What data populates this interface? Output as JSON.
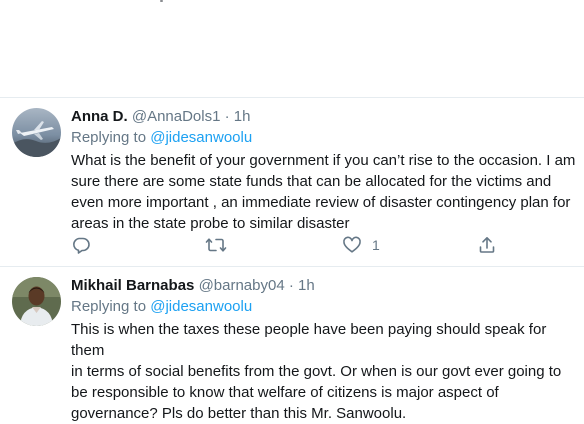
{
  "tweets": [
    {
      "author_name": "Anna D.",
      "handle": "@AnnaDols1",
      "time": "1h",
      "replying_prefix": "Replying to",
      "replying_to": "@jidesanwoolu",
      "body": "What is the benefit of your government if you can’t rise to the occasion. I am\nsure there are some state funds that can be allocated for the victims and\neven more important , an immediate review of disaster contingency plan for\nareas in the state probe to similar disaster",
      "actions": {
        "reply_icon": "reply-icon",
        "retweet_icon": "retweet-icon",
        "like_icon": "heart-icon",
        "like_count": "1",
        "share_icon": "share-icon"
      }
    },
    {
      "author_name": "Mikhail Barnabas",
      "handle": "@barnaby04",
      "time": "1h",
      "replying_prefix": "Replying to",
      "replying_to": "@jidesanwoolu",
      "body": "This is when the taxes these people have been paying should speak for them\nin terms of social benefits from the govt. Or when is our govt ever going to\nbe responsible to know that welfare of citizens is major aspect of\ngovernance? Pls do better than this Mr. Sanwoolu."
    }
  ],
  "separator": "·",
  "colors": {
    "text": "#14171a",
    "secondary": "#657786",
    "link": "#1da1f2",
    "divider": "#e6ecf0"
  }
}
